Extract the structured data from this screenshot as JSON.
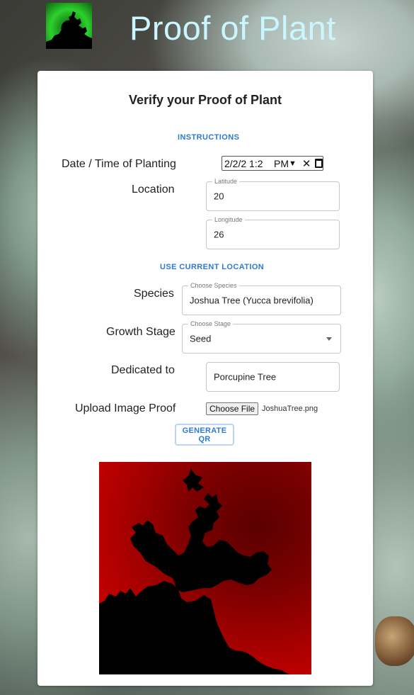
{
  "app": {
    "title": "Proof of Plant"
  },
  "card": {
    "title": "Verify your Proof of Plant",
    "instructions_button": "INSTRUCTIONS",
    "use_location_button": "USE CURRENT LOCATION",
    "generate_qr_button": "GENERATE QR"
  },
  "form": {
    "datetime": {
      "label": "Date / Time of Planting",
      "value": "2/2/2 1:2",
      "ampm": "PM"
    },
    "location": {
      "label": "Location",
      "latitude": {
        "label": "Latitude",
        "value": "20"
      },
      "longitude": {
        "label": "Longitude",
        "value": "26"
      }
    },
    "species": {
      "label": "Species",
      "field_label": "Choose Species",
      "value": "Joshua Tree (Yucca brevifolia)"
    },
    "growth_stage": {
      "label": "Growth Stage",
      "field_label": "Choose Stage",
      "value": "Seed"
    },
    "dedicated": {
      "label": "Dedicated to",
      "value": "Porcupine Tree"
    },
    "upload": {
      "label": "Upload Image Proof",
      "button": "Choose File",
      "file_name": "JoshuaTree.png"
    }
  },
  "icons": {
    "logo": "fractal-logo-icon",
    "clear": "close-icon",
    "calendar": "calendar-icon",
    "dropdown": "chevron-down-icon"
  },
  "colors": {
    "title": "#c9f6ff",
    "accent": "#2e7bd1",
    "logo_green": "#2dd12d",
    "qr_red": "#e00000"
  }
}
